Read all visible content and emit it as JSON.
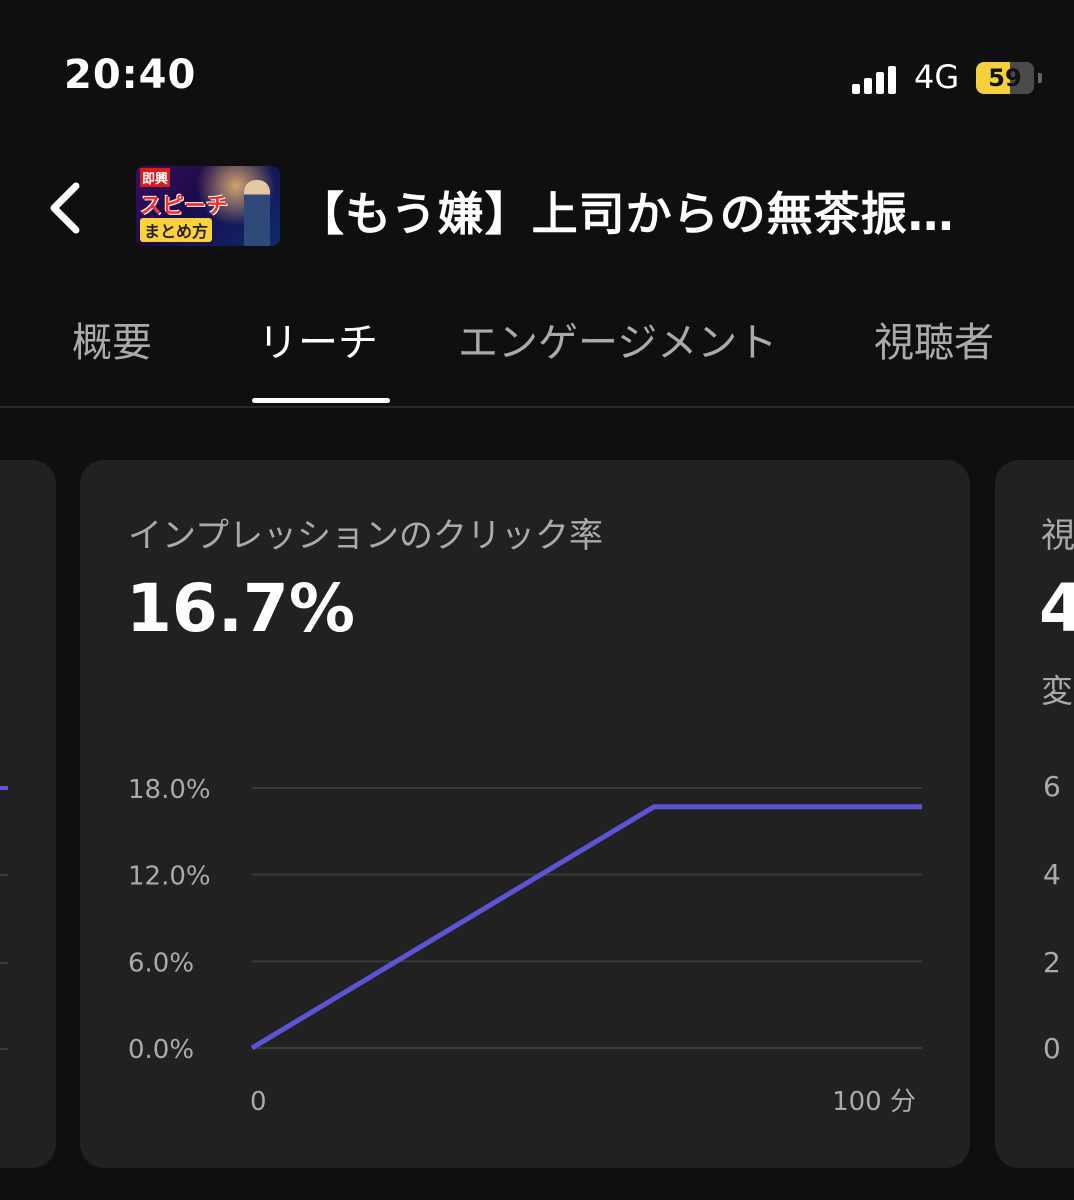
{
  "status": {
    "time": "20:40",
    "network": "4G",
    "battery": "59"
  },
  "header": {
    "title": "【もう嫌】上司からの無茶振…"
  },
  "thumbnail": {
    "line1": "即興",
    "line2": "スピーチ",
    "line3": "まとめ方"
  },
  "tabs": [
    "概要",
    "リーチ",
    "エンゲージメント",
    "視聴者"
  ],
  "active_tab": "リーチ",
  "card_main": {
    "label": "インプレッションのクリック率",
    "value": "16.7%"
  },
  "card_right": {
    "label": "視",
    "value": "4",
    "sub": "変",
    "ticks": [
      "6",
      "4",
      "2",
      "0"
    ]
  },
  "colors": {
    "accent": "#5b55d6",
    "background": "#0f0f0f",
    "card": "#212121"
  },
  "chart_data": {
    "type": "line",
    "x": [
      0,
      75,
      125
    ],
    "series": [
      {
        "values": [
          0.0,
          16.7,
          16.7
        ]
      }
    ],
    "ylim": [
      0,
      18
    ],
    "yticks": [
      "18.0%",
      "12.0%",
      "6.0%",
      "0.0%"
    ],
    "xticks": [
      "0",
      "100 分"
    ],
    "grid": true
  }
}
